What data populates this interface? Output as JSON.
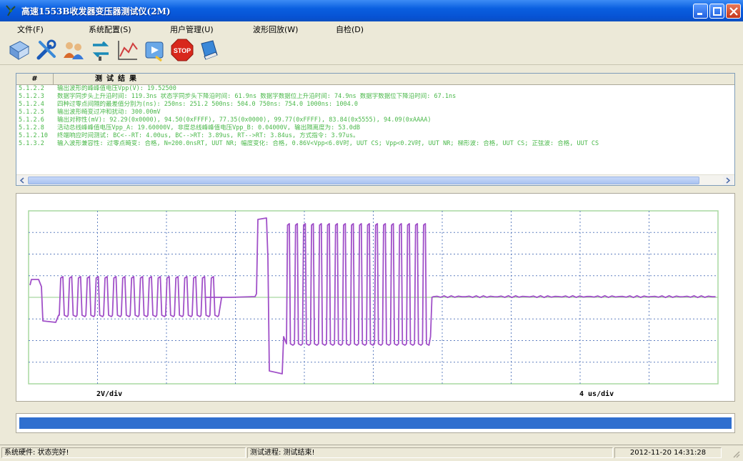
{
  "window": {
    "title": "高速1553B收发器变压器测试仪(2M)"
  },
  "menu": [
    {
      "label": "文件(F)"
    },
    {
      "label": "系统配置(S)"
    },
    {
      "label": "用户管理(U)"
    },
    {
      "label": "波形回放(W)"
    },
    {
      "label": "自检(D)"
    }
  ],
  "toolbar": [
    {
      "icon": "open-icon"
    },
    {
      "icon": "tools-icon"
    },
    {
      "icon": "users-icon"
    },
    {
      "icon": "test-icon"
    },
    {
      "icon": "waveform-icon"
    },
    {
      "icon": "playback-icon"
    },
    {
      "icon": "stop-icon",
      "label": "STOP"
    },
    {
      "icon": "help-book-icon"
    }
  ],
  "results": {
    "header_id": "#",
    "header_result": "测试结果",
    "rows": [
      {
        "id": "5.1.2.2",
        "text": "输出波形的峰峰值电压Vpp(V): 19.52500"
      },
      {
        "id": "5.1.2.3",
        "text": "数据字同步头上升沿时间: 119.3ns   状态字同步头下降沿时间: 61.9ns  数据字数据位上升沿时间: 74.9ns  数据字数据位下降沿时间: 67.1ns"
      },
      {
        "id": "5.1.2.4",
        "text": "四种过零点间隔的最差值分别为(ns): 250ns: 251.2  500ns: 504.0  750ns: 754.0  1000ns: 1004.0"
      },
      {
        "id": "5.1.2.5",
        "text": "输出波形畸变过冲和扰动: 300.00mV"
      },
      {
        "id": "5.1.2.6",
        "text": "输出对称性(mV): 92.29(0x0000), 94.50(0xFFFF), 77.35(0x0000), 99.77(0xFFFF), 83.84(0x5555), 94.09(0xAAAA)"
      },
      {
        "id": "5.1.2.8",
        "text": "活动总线峰峰值电压Vpp_A: 19.60000V, 非度总线峰峰值电压Vpp_B: 0.04000V, 输出隔离度为: 53.0dB"
      },
      {
        "id": "5.1.2.10",
        "text": "终端响应时间测试: BC<--RT: 4.00us, BC-->RT: 3.89us, RT-->RT: 3.84us, 方式指令: 3.97us。"
      },
      {
        "id": "5.1.3.2",
        "text": "输入波形兼容性: 过零点畸变: 合格, N=200.0nsRT, UUT NR;  幅度变化: 合格, 0.86V<Vpp<6.0V时, UUT CS; Vpp<0.2V时, UUT NR;  梯形波: 合格, UUT CS;  正弦波: 合格, UUT CS"
      }
    ]
  },
  "scope": {
    "volt_div": "2V/div",
    "time_div": "4 us/div",
    "colors": {
      "trace": "#a050c8",
      "grid_border": "#a8d8a0",
      "grid_dots": "#6080c0"
    }
  },
  "progress": {
    "fraction": 1.0,
    "color": "#2f6fcf"
  },
  "status": {
    "hardware": "系统硬件: 状态完好!",
    "process": "测试进程: 测试结束!",
    "datetime": "2012-11-20 14:31:28"
  }
}
